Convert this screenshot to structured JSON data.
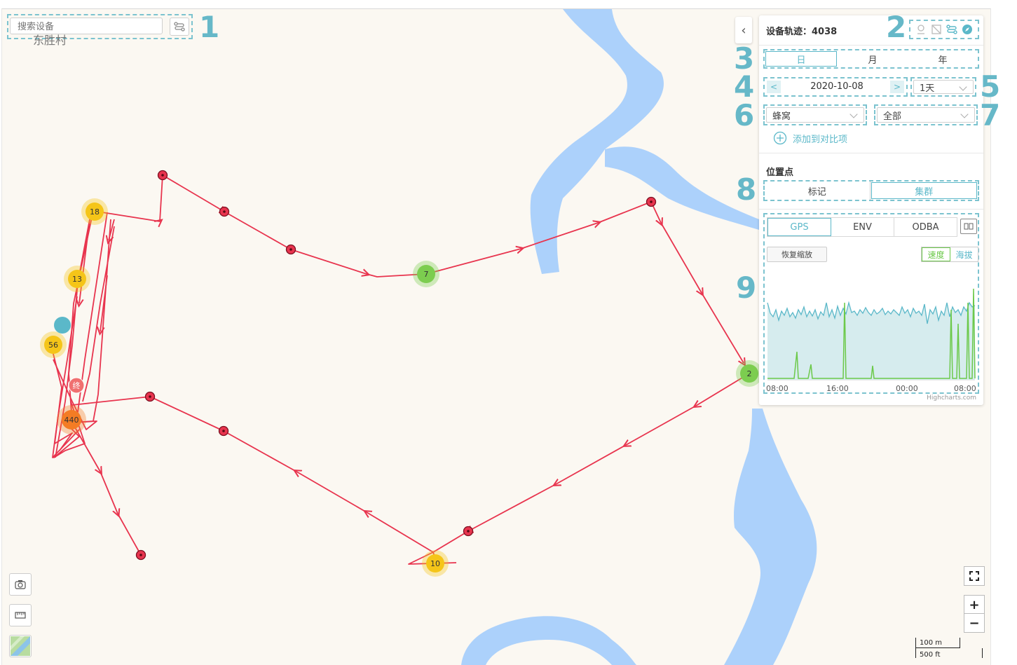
{
  "search": {
    "placeholder": "搜索设备"
  },
  "map": {
    "village_label": "东胜村"
  },
  "clusters": [
    "18",
    "13",
    "56",
    "440",
    "7",
    "2",
    "10"
  ],
  "end_marker": "终",
  "panel": {
    "title": "设备轨迹：4038",
    "period_tabs": [
      "日",
      "月",
      "年"
    ],
    "date": {
      "prev": "<",
      "value": "2020-10-08",
      "next": ">"
    },
    "span_select": "1天",
    "source_select": "蜂窝",
    "filter_select": "全部",
    "add_compare": "添加到对比项",
    "position_title": "位置点",
    "position_tabs": [
      "标记",
      "集群"
    ],
    "sensor_tabs": [
      "GPS",
      "ENV",
      "ODBA"
    ],
    "reset_zoom": "恢复缩放",
    "metric_tabs": [
      "速度",
      "海拔"
    ],
    "x_ticks": [
      "08:00",
      "16:00",
      "00:00",
      "08:00"
    ],
    "credit": "Highcharts.com"
  },
  "scale": {
    "metric": "100 m",
    "imperial": "500 ft"
  },
  "callouts": [
    "1",
    "2",
    "3",
    "4",
    "5",
    "6",
    "7",
    "8",
    "9"
  ],
  "colors": {
    "accent": "#5bb8c9",
    "track": "#e8344e",
    "water": "#acd1fb",
    "cluster_yellow": "#f5c518",
    "cluster_green": "#7ccd4f",
    "cluster_orange": "#f47c24",
    "speed_line": "#5bb8c9",
    "altitude_line": "#6cc94a"
  }
}
